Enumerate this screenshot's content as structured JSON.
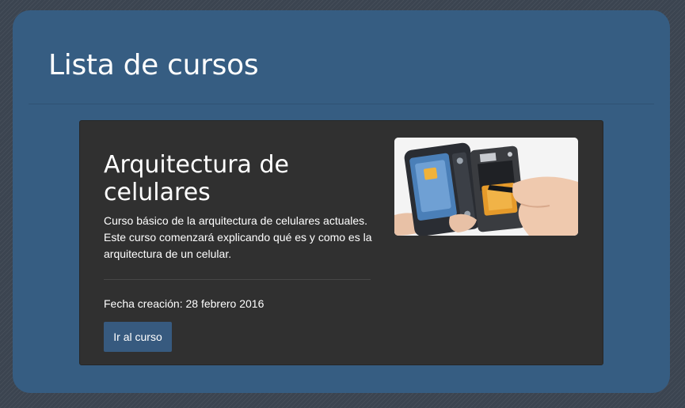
{
  "page": {
    "title": "Lista de cursos"
  },
  "course": {
    "title": "Arquitectura de celulares",
    "description": "Curso básico de la arquitectura de celulares actuales. Este curso comenzará explicando qué es y como es la arquitectura de un celular.",
    "date": "Fecha creación: 28 febrero 2016",
    "button_label": "Ir al curso",
    "image_subject": "phone-disassembly-photo"
  },
  "colors": {
    "panel": "#365d82",
    "card": "#303030",
    "button": "#375a7f",
    "text": "#ffffff"
  }
}
